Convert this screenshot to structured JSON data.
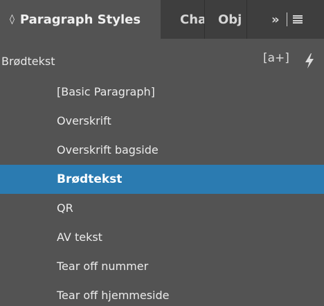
{
  "tabs": [
    {
      "label": "Paragraph Styles",
      "chevron": "◊",
      "active": true
    },
    {
      "label": "Cha"
    },
    {
      "label": "Obj"
    }
  ],
  "tab_controls": {
    "more": "»"
  },
  "current_style": {
    "label": "Brødtekst",
    "override_label": "[a+]"
  },
  "styles": [
    {
      "label": "[Basic Paragraph]"
    },
    {
      "label": "Overskrift"
    },
    {
      "label": "Overskrift bagside"
    },
    {
      "label": "Brødtekst",
      "selected": true
    },
    {
      "label": "QR"
    },
    {
      "label": "AV tekst"
    },
    {
      "label": "Tear off nummer"
    },
    {
      "label": "Tear off hjemmeside"
    }
  ],
  "colors": {
    "panel_bg": "#535353",
    "tabbar_bg": "#3e3e3e",
    "selection": "#2b7bb1"
  }
}
